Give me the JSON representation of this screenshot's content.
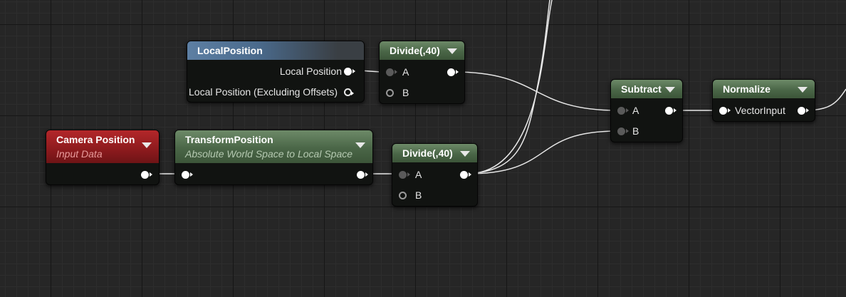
{
  "nodes": {
    "local_position": {
      "title": "LocalPosition",
      "outputs": [
        "Local Position",
        "Local Position (Excluding Offsets)"
      ]
    },
    "divide_top": {
      "title": "Divide(,40)",
      "inputs": [
        "A",
        "B"
      ]
    },
    "camera_position": {
      "title": "Camera Position",
      "subtitle": "Input Data"
    },
    "transform_position": {
      "title": "TransformPosition",
      "subtitle": "Absolute World Space to Local Space"
    },
    "divide_bottom": {
      "title": "Divide(,40)",
      "inputs": [
        "A",
        "B"
      ]
    },
    "subtract": {
      "title": "Subtract",
      "inputs": [
        "A",
        "B"
      ]
    },
    "normalize": {
      "title": "Normalize",
      "inputs": [
        "VectorInput"
      ]
    }
  },
  "colors": {
    "background": "#262626",
    "header_green": "#4a6647",
    "header_blue": "#4a6a8c",
    "header_red": "#8c1a1d",
    "subtitle_red": "#e89a9a",
    "subtitle_green": "#b5c9b1",
    "wire": "#e8e8e8"
  }
}
